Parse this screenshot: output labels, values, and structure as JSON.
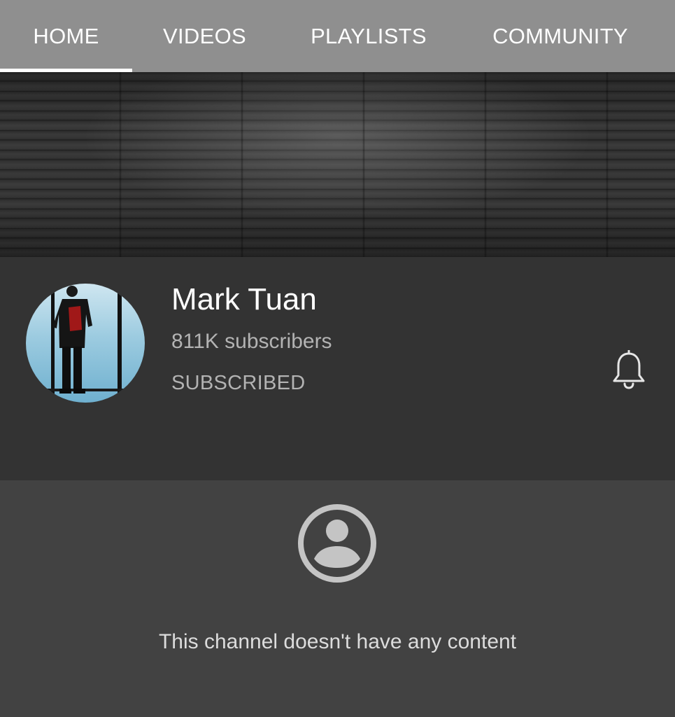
{
  "tabs": [
    {
      "label": "HOME",
      "selected": true
    },
    {
      "label": "VIDEOS",
      "selected": false
    },
    {
      "label": "PLAYLISTS",
      "selected": false
    },
    {
      "label": "COMMUNITY",
      "selected": false
    }
  ],
  "channel": {
    "name": "Mark Tuan",
    "subscribers": "811K subscribers",
    "subscribe_state": "SUBSCRIBED",
    "notification_icon": "bell-icon"
  },
  "empty_state": {
    "icon": "account-circle-icon",
    "message": "This channel doesn't have any content"
  },
  "colors": {
    "tab_bar": "#8f8f8f",
    "header_bg": "#333333",
    "content_bg": "#424242",
    "text_primary": "#ffffff",
    "text_secondary": "#b3b3b3"
  }
}
